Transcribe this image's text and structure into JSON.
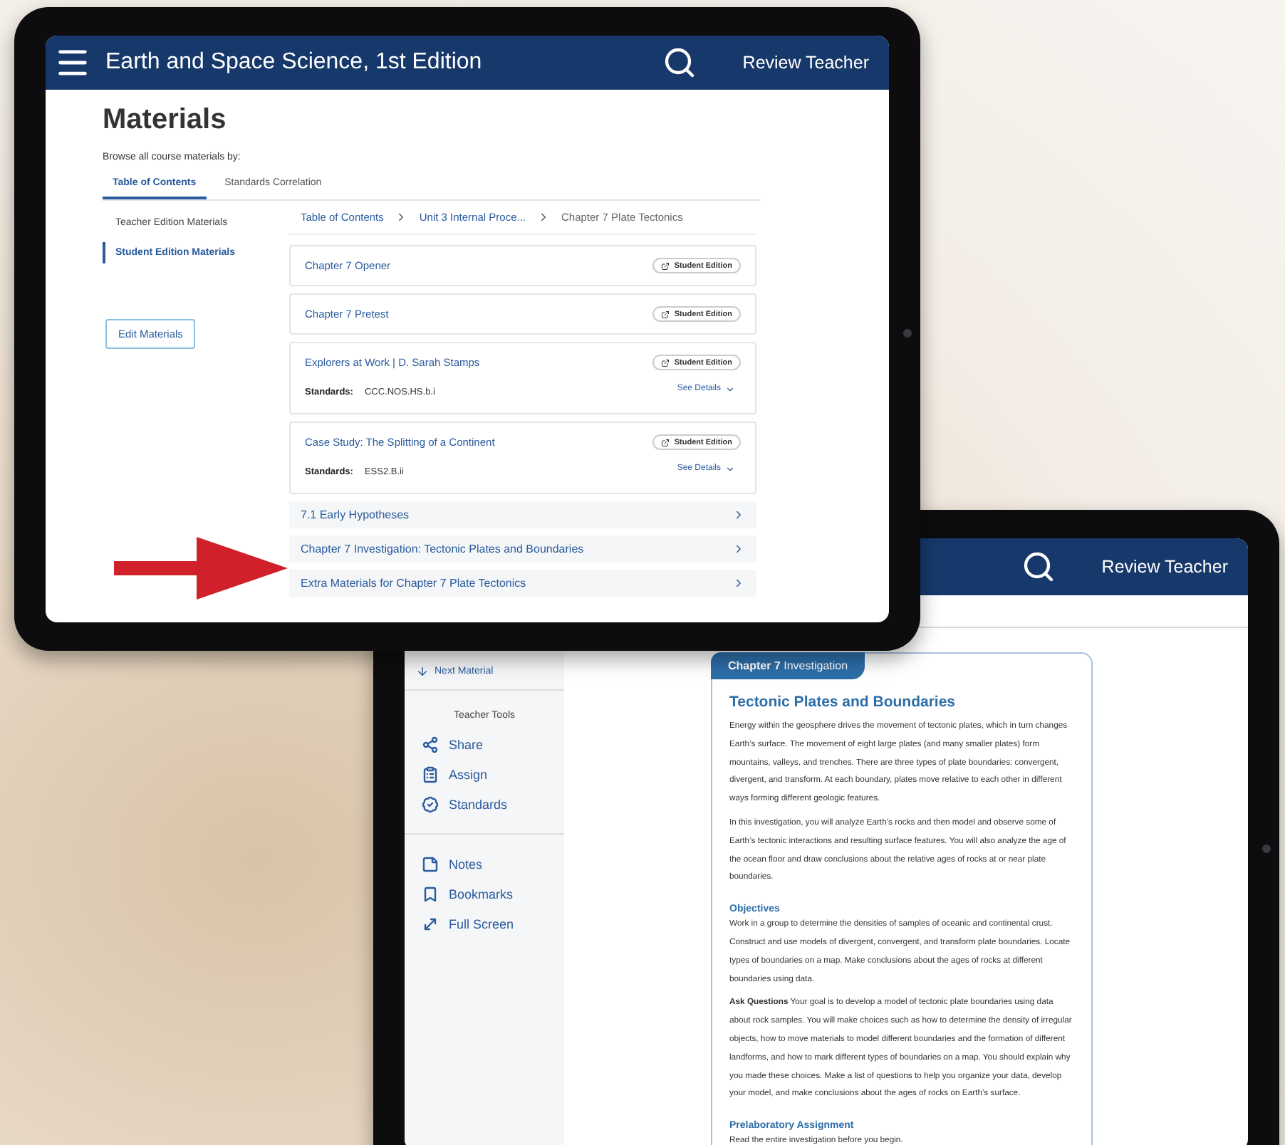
{
  "materials_screen": {
    "header": {
      "title": "Earth and Space Science, 1st Edition",
      "action": "Review Teacher"
    },
    "heading": "Materials",
    "browse_label": "Browse all course materials by:",
    "tabs": [
      {
        "label": "Table of Contents",
        "selected": true
      },
      {
        "label": "Standards Correlation",
        "selected": false
      }
    ],
    "side_nav": [
      {
        "label": "Teacher Edition Materials",
        "selected": false
      },
      {
        "label": "Student Edition Materials",
        "selected": true
      }
    ],
    "edit_button": "Edit Materials",
    "breadcrumb": [
      "Table of Contents",
      "Unit 3 Internal Proce...",
      "Chapter 7 Plate Tectonics"
    ],
    "materials": [
      {
        "title": "Chapter 7 Opener",
        "badge": "Student Edition"
      },
      {
        "title": "Chapter 7 Pretest",
        "badge": "Student Edition"
      },
      {
        "title": "Explorers at Work | D. Sarah Stamps",
        "badge": "Student Edition",
        "standards_label": "Standards:",
        "standards": "CCC.NOS.HS.b.i",
        "details": "See Details"
      },
      {
        "title": "Case Study: The Splitting of a Continent",
        "badge": "Student Edition",
        "standards_label": "Standards:",
        "standards": "ESS2.B.ii",
        "details": "See Details"
      }
    ],
    "sections": [
      "7.1 Early Hypotheses",
      "Chapter 7 Investigation: Tectonic Plates and Boundaries",
      "Extra Materials for Chapter 7 Plate Tectonics"
    ]
  },
  "reader_screen": {
    "header": {
      "action": "Review Teacher"
    },
    "next_material": "Next Material",
    "tools_heading": "Teacher Tools",
    "tool_groups": [
      [
        {
          "label": "Share",
          "kind": "share"
        },
        {
          "label": "Assign",
          "kind": "assign"
        },
        {
          "label": "Standards",
          "kind": "standards"
        }
      ],
      [
        {
          "label": "Notes",
          "kind": "notes"
        },
        {
          "label": "Bookmarks",
          "kind": "bookmarks"
        },
        {
          "label": "Full Screen",
          "kind": "fullscreen"
        }
      ]
    ],
    "card": {
      "tab": "**Chapter 7** Investigation",
      "title": "Tectonic Plates and Boundaries",
      "blocks": [
        {
          "kind": "text",
          "text": "Energy within the geosphere drives the movement of tectonic plates, which in turn changes Earth’s surface. The movement of eight large plates (and many smaller plates) form mountains, valleys, and trenches. There are three types of plate boundaries: convergent, divergent, and transform. At each boundary, plates move relative to each other in different ways forming different geologic features."
        },
        {
          "kind": "text",
          "text": "In this investigation, you will analyze Earth’s rocks and then model and observe some of Earth’s tectonic interactions and resulting surface features. You will also analyze the age of the ocean floor and draw conclusions about the relative ages of rocks at or near plate boundaries."
        },
        {
          "kind": "heading",
          "text": "Objectives"
        },
        {
          "kind": "text",
          "text": "Work in a group to determine the densities of samples of oceanic and continental crust. Construct and use models of divergent, convergent, and transform plate boundaries. Locate types of boundaries on a map. Make conclusions about the ages of rocks at different boundaries using data."
        },
        {
          "kind": "text",
          "text": "**Ask Questions** Your goal is to develop a model of tectonic plate boundaries using data about rock samples. You will make choices such as how to determine the density of irregular objects, how to move materials to model different boundaries and the formation of different landforms, and how to mark different types of boundaries on a map. You should explain why you made these choices. Make a list of questions to help you organize your data, develop your model, and make conclusions about the ages of rocks on Earth’s surface."
        },
        {
          "kind": "heading",
          "text": "Prelaboratory Assignment"
        },
        {
          "kind": "text",
          "text": "Read the entire investigation before you begin."
        }
      ]
    }
  }
}
